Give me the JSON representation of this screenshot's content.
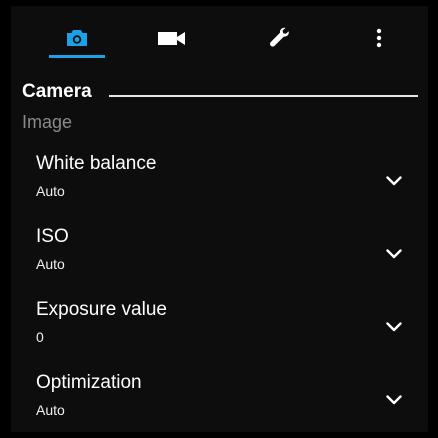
{
  "tabs": [
    {
      "icon": "camera-icon",
      "active": true
    },
    {
      "icon": "video-icon",
      "active": false
    },
    {
      "icon": "wrench-icon",
      "active": false
    },
    {
      "icon": "more-vertical-icon",
      "active": false
    }
  ],
  "section": {
    "title": "Camera"
  },
  "group": {
    "label": "Image"
  },
  "settings": [
    {
      "title": "White balance",
      "value": "Auto"
    },
    {
      "title": "ISO",
      "value": "Auto"
    },
    {
      "title": "Exposure value",
      "value": "0"
    },
    {
      "title": "Optimization",
      "value": "Auto"
    }
  ],
  "colors": {
    "accent": "#1ea0e6",
    "background": "#0d0d0d",
    "group_label": "#8a8a8a"
  }
}
